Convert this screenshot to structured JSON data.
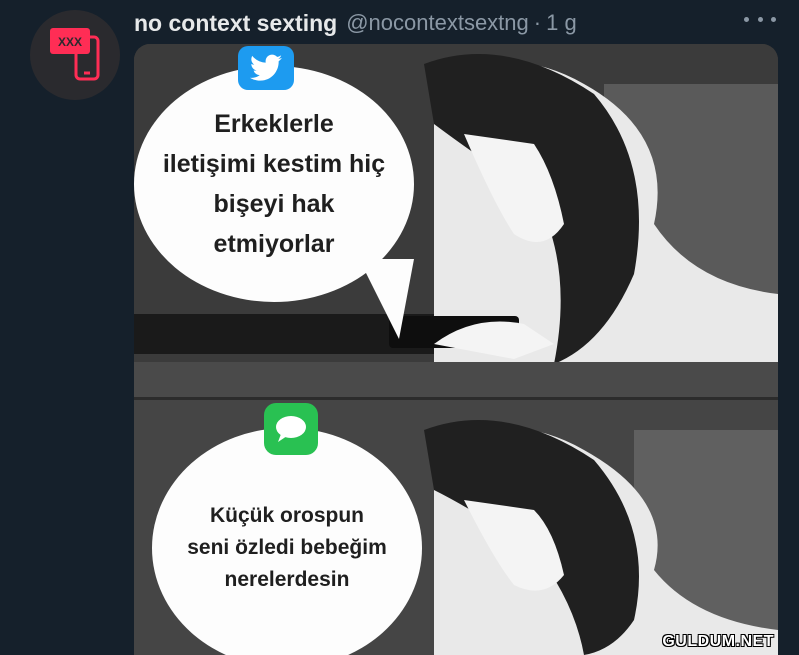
{
  "tweet": {
    "display_name": "no context sexting",
    "handle": "@nocontextsextng",
    "separator": "·",
    "time": "1 g"
  },
  "avatar": {
    "badge_text": "XXX",
    "accent": "#ff2d55"
  },
  "meme": {
    "top_app_icon": "twitter-bird-icon",
    "top_text": "Erkeklerle\niletişimi kestim hiç\nbişeyi hak\netmiyorlar",
    "bottom_app_icon": "messages-icon",
    "bottom_text": "Küçük orospun\nseni özledi bebeğim\nnerelerdesin",
    "watermark": "GULDUM.NET"
  },
  "colors": {
    "background": "#15202b",
    "twitter_blue": "#1d9bf0",
    "messages_green": "#29c152"
  }
}
